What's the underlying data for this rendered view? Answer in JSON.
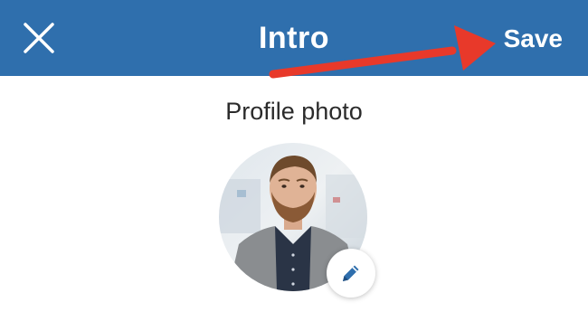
{
  "header": {
    "title": "Intro",
    "save_label": "Save",
    "close_icon": "close-icon",
    "background_color": "#2f6fad"
  },
  "annotation": {
    "arrow_color": "#e8392a",
    "icon": "arrow-icon"
  },
  "profile_photo": {
    "label": "Profile photo",
    "edit_icon": "pencil-icon",
    "edit_icon_color": "#2f6fad"
  }
}
